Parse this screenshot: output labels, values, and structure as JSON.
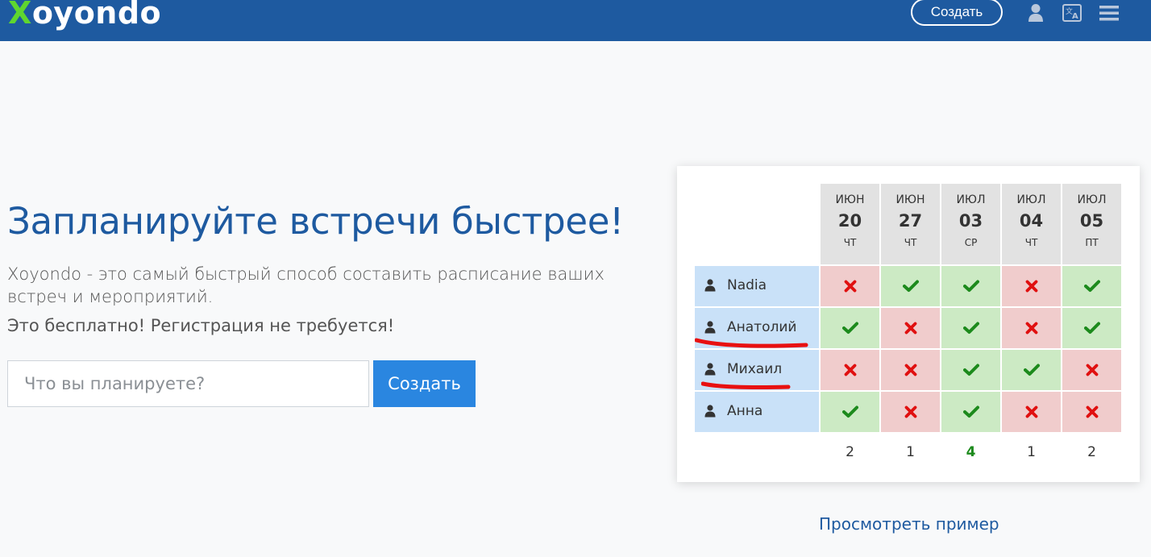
{
  "header": {
    "logo_x": "X",
    "logo_rest": "oyondo",
    "create_label": "Создать"
  },
  "hero": {
    "title": "Запланируйте встречи быстрее!",
    "description": "Xoyondo - это самый быстрый способ составить расписание ваших встреч и мероприятий.",
    "free_text": "Это бесплатно! Регистрация не требуется!",
    "input_placeholder": "Что вы планируете?",
    "input_value": "",
    "create_label": "Создать"
  },
  "poll": {
    "dates": [
      {
        "month": "ИЮН",
        "day": "20",
        "weekday": "ЧТ",
        "total": "2",
        "best": false
      },
      {
        "month": "ИЮН",
        "day": "27",
        "weekday": "ЧТ",
        "total": "1",
        "best": false
      },
      {
        "month": "ИЮЛ",
        "day": "03",
        "weekday": "СР",
        "total": "4",
        "best": true
      },
      {
        "month": "ИЮЛ",
        "day": "04",
        "weekday": "ЧТ",
        "total": "1",
        "best": false
      },
      {
        "month": "ИЮЛ",
        "day": "05",
        "weekday": "ПТ",
        "total": "2",
        "best": false
      }
    ],
    "participants": [
      {
        "name": "Nadia",
        "votes": [
          "no",
          "yes",
          "yes",
          "no",
          "yes"
        ],
        "underlined": false
      },
      {
        "name": "Анатолий",
        "votes": [
          "yes",
          "no",
          "yes",
          "no",
          "yes"
        ],
        "underlined": true
      },
      {
        "name": "Михаил",
        "votes": [
          "no",
          "no",
          "yes",
          "yes",
          "no"
        ],
        "underlined": true
      },
      {
        "name": "Анна",
        "votes": [
          "yes",
          "no",
          "yes",
          "no",
          "no"
        ],
        "underlined": false
      }
    ]
  },
  "example_link": "Просмотреть пример",
  "colors": {
    "brand": "#1e5aa0",
    "logo_accent": "#5fd62f",
    "button": "#2a86e0",
    "yes_bg": "#cceac4",
    "no_bg": "#f0cccc",
    "yes_mark": "#1c8a1c",
    "no_mark": "#e01010",
    "annotation": "#e81010"
  }
}
